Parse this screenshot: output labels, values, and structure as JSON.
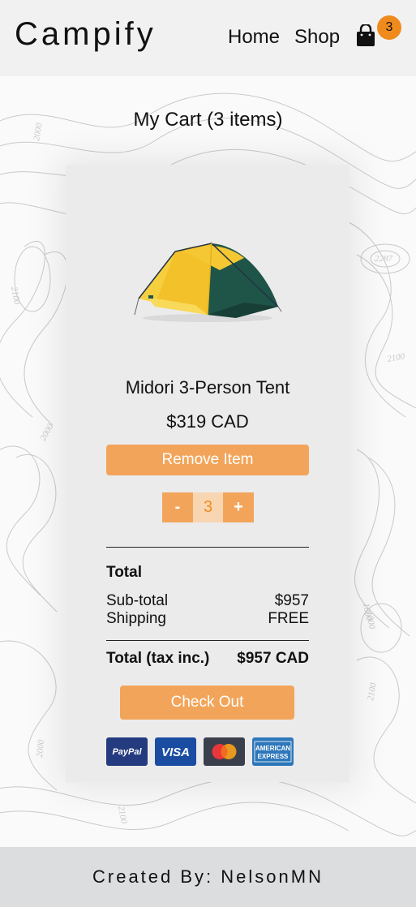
{
  "header": {
    "logo": "Campify",
    "nav": {
      "home": "Home",
      "shop": "Shop"
    },
    "cart_count": "3",
    "cart_icon": "shopping-bag-icon"
  },
  "cart": {
    "title": "My Cart (3 items)",
    "item": {
      "name": "Midori 3-Person Tent",
      "price": "$319 CAD",
      "remove_label": "Remove Item",
      "quantity": "3",
      "decrement_label": "-",
      "increment_label": "+"
    },
    "summary": {
      "heading": "Total",
      "subtotal_label": "Sub-total",
      "subtotal_value": "$957",
      "shipping_label": "Shipping",
      "shipping_value": "FREE",
      "total_label": "Total (tax inc.)",
      "total_value": "$957 CAD"
    },
    "checkout_label": "Check Out",
    "payment_methods": {
      "paypal": "PayPal",
      "visa": "VISA",
      "mastercard_icon": "mastercard-icon",
      "amex_line1": "AMERICAN",
      "amex_line2": "EXPRESS"
    }
  },
  "background_labels": [
    "2000",
    "2100",
    "2287",
    "2100",
    "2000",
    "1800",
    "2100",
    "2000",
    "2100",
    "1800"
  ],
  "footer": {
    "credit": "Created By: NelsonMN"
  },
  "colors": {
    "accent": "#f2a55a",
    "badge": "#ef8b1d",
    "paypal": "#253b80",
    "visa": "#1a4da1",
    "mastercard_bg": "#3a3f4b",
    "amex": "#2e77bb"
  }
}
